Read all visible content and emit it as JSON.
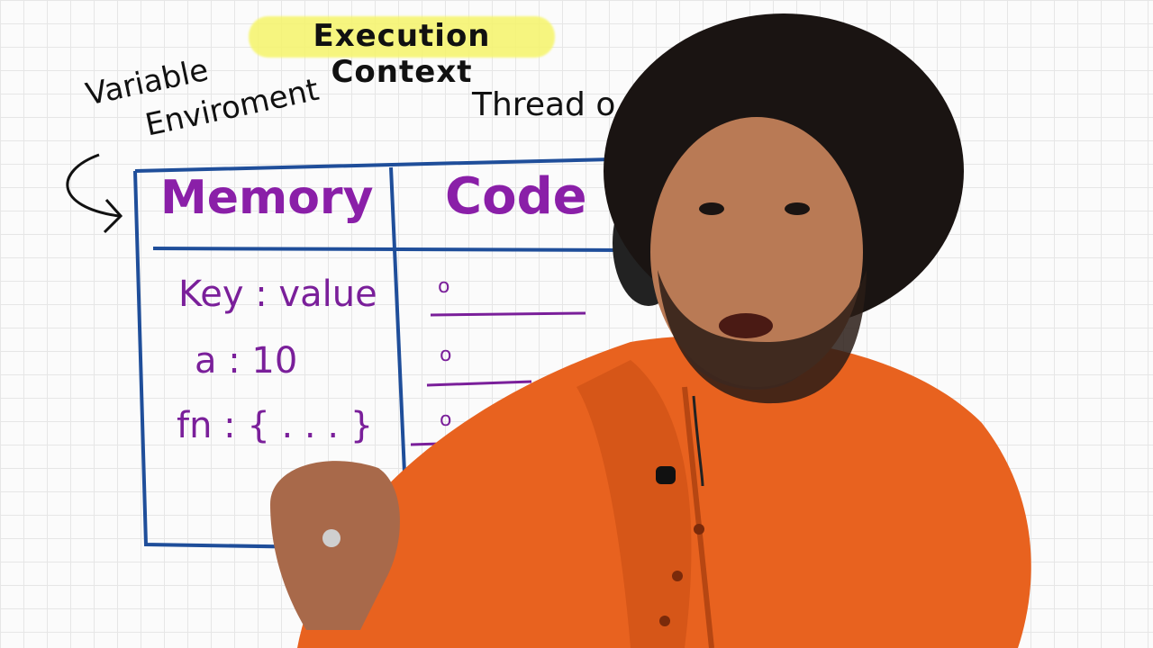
{
  "title": "Execution Context",
  "labels": {
    "variable": "Variable",
    "environment": "Enviroment",
    "thread": "Thread o"
  },
  "table": {
    "memory_header": "Memory",
    "code_header": "Code",
    "memory_rows": [
      "Key : value",
      "a : 10",
      "fn : { . . . }"
    ],
    "code_markers": [
      "o",
      "o",
      "o"
    ]
  },
  "colors": {
    "box_stroke": "#1f4e9a",
    "handwriting_purple": "#8a1fa8",
    "highlight_yellow": "#f6f56a",
    "shirt_orange": "#e8621f",
    "skin": "#b97a55",
    "hair": "#1a1412"
  }
}
